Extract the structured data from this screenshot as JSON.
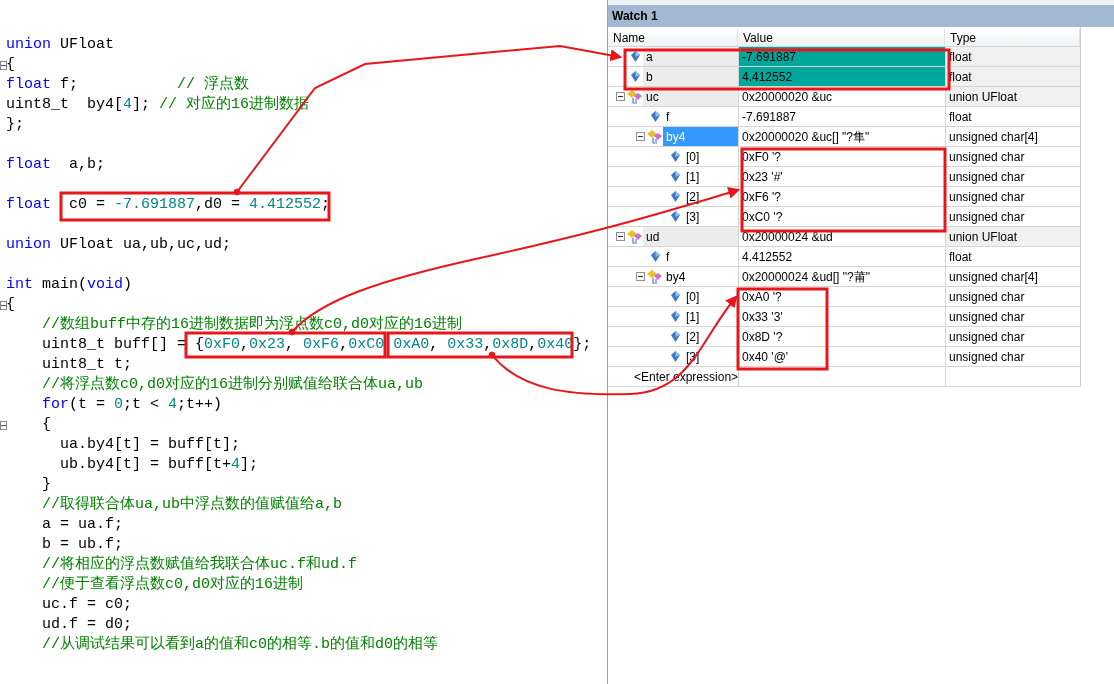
{
  "editor": {
    "lines": [
      {
        "kind": "code",
        "tokens": [
          {
            "text": "union",
            "kind": "keyword"
          },
          {
            "text": " UFloat",
            "kind": "plain"
          }
        ]
      },
      {
        "kind": "code",
        "fold": true,
        "tokens": [
          {
            "text": "{",
            "kind": "plain"
          }
        ]
      },
      {
        "kind": "code",
        "tokens": [
          {
            "text": "float",
            "kind": "keyword"
          },
          {
            "text": " f;           ",
            "kind": "plain"
          },
          {
            "text": "// 浮点数",
            "kind": "comment"
          }
        ]
      },
      {
        "kind": "code",
        "tokens": [
          {
            "text": "uint8_t  by4[",
            "kind": "plain"
          },
          {
            "text": "4",
            "kind": "number"
          },
          {
            "text": "]; ",
            "kind": "plain"
          },
          {
            "text": "// 对应的16进制数据",
            "kind": "comment"
          }
        ]
      },
      {
        "kind": "code",
        "tokens": [
          {
            "text": "};",
            "kind": "plain"
          }
        ]
      },
      {
        "kind": "blank"
      },
      {
        "kind": "code",
        "tokens": [
          {
            "text": "float",
            "kind": "keyword"
          },
          {
            "text": "  a,b;",
            "kind": "plain"
          }
        ]
      },
      {
        "kind": "blank"
      },
      {
        "kind": "code",
        "tokens": [
          {
            "text": "float",
            "kind": "keyword"
          },
          {
            "text": "  c0 = ",
            "kind": "plain"
          },
          {
            "text": "-7.691887",
            "kind": "number"
          },
          {
            "text": ",d0 = ",
            "kind": "plain"
          },
          {
            "text": "4.412552",
            "kind": "number"
          },
          {
            "text": ";",
            "kind": "plain"
          }
        ]
      },
      {
        "kind": "blank"
      },
      {
        "kind": "code",
        "tokens": [
          {
            "text": "union",
            "kind": "keyword"
          },
          {
            "text": " UFloat ua,ub,uc,ud;",
            "kind": "plain"
          }
        ]
      },
      {
        "kind": "blank"
      },
      {
        "kind": "code",
        "tokens": [
          {
            "text": "int",
            "kind": "keyword"
          },
          {
            "text": " main(",
            "kind": "plain"
          },
          {
            "text": "void",
            "kind": "keyword"
          },
          {
            "text": ")",
            "kind": "plain"
          }
        ]
      },
      {
        "kind": "code",
        "fold": true,
        "tokens": [
          {
            "text": "{",
            "kind": "plain"
          }
        ]
      },
      {
        "kind": "code",
        "tokens": [
          {
            "text": "    //数组buff中存的16进制数据即为浮点数c0,d0对应的16进制",
            "kind": "comment"
          }
        ]
      },
      {
        "kind": "code",
        "tokens": [
          {
            "text": "    uint8_t buff[] = {",
            "kind": "plain"
          },
          {
            "text": "0xF0",
            "kind": "number"
          },
          {
            "text": ",",
            "kind": "plain"
          },
          {
            "text": "0x23",
            "kind": "number"
          },
          {
            "text": ", ",
            "kind": "plain"
          },
          {
            "text": "0xF6",
            "kind": "number"
          },
          {
            "text": ",",
            "kind": "plain"
          },
          {
            "text": "0xC0 ",
            "kind": "number"
          },
          {
            "text": "0xA0",
            "kind": "number"
          },
          {
            "text": ", ",
            "kind": "plain"
          },
          {
            "text": "0x33",
            "kind": "number"
          },
          {
            "text": ",",
            "kind": "plain"
          },
          {
            "text": "0x8D",
            "kind": "number"
          },
          {
            "text": ",",
            "kind": "plain"
          },
          {
            "text": "0x40",
            "kind": "number"
          },
          {
            "text": "};",
            "kind": "plain"
          }
        ]
      },
      {
        "kind": "code",
        "tokens": [
          {
            "text": "    uint8_t t;",
            "kind": "plain"
          }
        ]
      },
      {
        "kind": "code",
        "tokens": [
          {
            "text": "    //将浮点数c0,d0对应的16进制分别赋值给联合体ua,ub",
            "kind": "comment"
          }
        ]
      },
      {
        "kind": "code",
        "tokens": [
          {
            "text": "    for",
            "kind": "keyword"
          },
          {
            "text": "(t = ",
            "kind": "plain"
          },
          {
            "text": "0",
            "kind": "number"
          },
          {
            "text": ";t < ",
            "kind": "plain"
          },
          {
            "text": "4",
            "kind": "number"
          },
          {
            "text": ";t++)",
            "kind": "plain"
          }
        ]
      },
      {
        "kind": "code",
        "fold": true,
        "tokens": [
          {
            "text": "    {",
            "kind": "plain"
          }
        ]
      },
      {
        "kind": "code",
        "tokens": [
          {
            "text": "      ua.by4[t] = buff[t];",
            "kind": "plain"
          }
        ]
      },
      {
        "kind": "code",
        "tokens": [
          {
            "text": "      ub.by4[t] = buff[t+",
            "kind": "plain"
          },
          {
            "text": "4",
            "kind": "number"
          },
          {
            "text": "];",
            "kind": "plain"
          }
        ]
      },
      {
        "kind": "code",
        "tokens": [
          {
            "text": "    }",
            "kind": "plain"
          }
        ]
      },
      {
        "kind": "code",
        "tokens": [
          {
            "text": "    //取得联合体ua,ub中浮点数的值赋值给a,b",
            "kind": "comment"
          }
        ]
      },
      {
        "kind": "code",
        "tokens": [
          {
            "text": "    a = ua.f;",
            "kind": "plain"
          }
        ]
      },
      {
        "kind": "code",
        "tokens": [
          {
            "text": "    b = ub.f;",
            "kind": "plain"
          }
        ]
      },
      {
        "kind": "code",
        "tokens": [
          {
            "text": "    //将相应的浮点数赋值给我联合体uc.f和ud.f",
            "kind": "comment"
          }
        ]
      },
      {
        "kind": "code",
        "tokens": [
          {
            "text": "    //便于查看浮点数c0,d0对应的16进制",
            "kind": "comment"
          }
        ]
      },
      {
        "kind": "code",
        "tokens": [
          {
            "text": "    uc.f = c0;",
            "kind": "plain"
          }
        ]
      },
      {
        "kind": "code",
        "tokens": [
          {
            "text": "    ud.f = d0;",
            "kind": "plain"
          }
        ]
      },
      {
        "kind": "code",
        "tokens": [
          {
            "text": "    //从调试结果可以看到a的值和c0的相等.b的值和d0的相等",
            "kind": "comment"
          }
        ]
      }
    ]
  },
  "watch": {
    "title": "Watch 1",
    "columns": [
      "Name",
      "Value",
      "Type"
    ],
    "items": [
      {
        "kind": "variable",
        "name": "a",
        "value": "-7.691887",
        "type": "float",
        "highlighted": true,
        "selected": false
      },
      {
        "kind": "variable",
        "name": "b",
        "value": "4.412552",
        "type": "float",
        "highlighted": true,
        "selected": false
      },
      {
        "kind": "struct",
        "name": "uc",
        "value": "0x20000020 &uc",
        "type": "union UFloat",
        "highlighted": false,
        "selected": false,
        "expanded": true,
        "children": [
          {
            "kind": "variable",
            "name": "f",
            "value": "-7.691887",
            "type": "float",
            "highlighted": false,
            "selected": false
          },
          {
            "kind": "struct",
            "name": "by4",
            "value": "0x20000020 &uc[] \"?隼\"",
            "type": "unsigned char[4]",
            "highlighted": false,
            "selected": true,
            "expanded": true,
            "children": [
              {
                "kind": "variable",
                "name": "[0]",
                "value": "0xF0 '?",
                "type": "unsigned char",
                "highlighted": false,
                "selected": false
              },
              {
                "kind": "variable",
                "name": "[1]",
                "value": "0x23 '#'",
                "type": "unsigned char",
                "highlighted": false,
                "selected": false
              },
              {
                "kind": "variable",
                "name": "[2]",
                "value": "0xF6 '?",
                "type": "unsigned char",
                "highlighted": false,
                "selected": false
              },
              {
                "kind": "variable",
                "name": "[3]",
                "value": "0xC0 '?",
                "type": "unsigned char",
                "highlighted": false,
                "selected": false
              }
            ]
          }
        ]
      },
      {
        "kind": "struct",
        "name": "ud",
        "value": "0x20000024 &ud",
        "type": "union UFloat",
        "highlighted": false,
        "selected": false,
        "expanded": true,
        "children": [
          {
            "kind": "variable",
            "name": "f",
            "value": "4.412552",
            "type": "float",
            "highlighted": false,
            "selected": false
          },
          {
            "kind": "struct",
            "name": "by4",
            "value": "0x20000024 &ud[] \"?莆\"",
            "type": "unsigned char[4]",
            "highlighted": false,
            "selected": false,
            "expanded": true,
            "children": [
              {
                "kind": "variable",
                "name": "[0]",
                "value": "0xA0 '?",
                "type": "unsigned char",
                "highlighted": false,
                "selected": false
              },
              {
                "kind": "variable",
                "name": "[1]",
                "value": "0x33 '3'",
                "type": "unsigned char",
                "highlighted": false,
                "selected": false
              },
              {
                "kind": "variable",
                "name": "[2]",
                "value": "0x8D '?",
                "type": "unsigned char",
                "highlighted": false,
                "selected": false
              },
              {
                "kind": "variable",
                "name": "[3]",
                "value": "0x40 '@'",
                "type": "unsigned char",
                "highlighted": false,
                "selected": false
              }
            ]
          }
        ]
      }
    ],
    "enter_expression": "<Enter expression>"
  }
}
